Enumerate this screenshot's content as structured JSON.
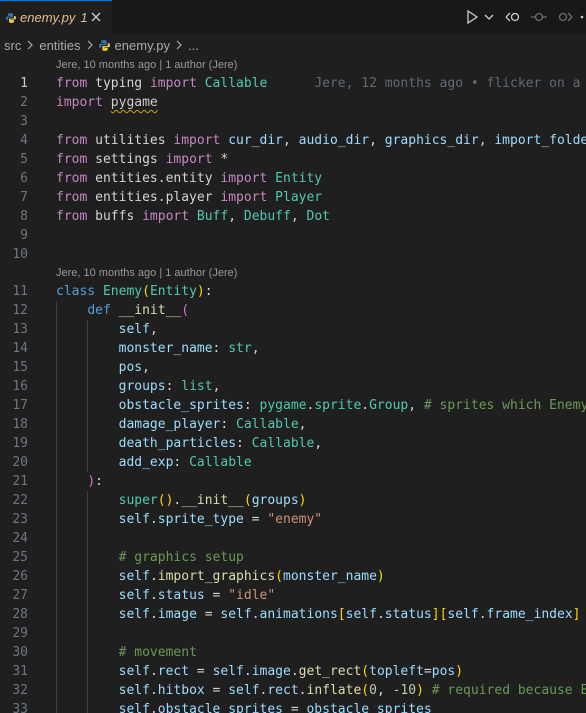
{
  "tab": {
    "filename": "enemy.py",
    "problem_count": "1"
  },
  "breadcrumb": [
    "src",
    "entities",
    "enemy.py",
    "..."
  ],
  "codelens": [
    {
      "before_line": 1,
      "text": "Jere, 10 months ago | 1 author (Jere)"
    },
    {
      "before_line": 11,
      "text": "Jere, 10 months ago | 1 author (Jere)"
    }
  ],
  "inline_blame": "Jere, 12 months ago • flicker on a",
  "lines": [
    {
      "n": "1",
      "tokens": [
        [
          "ctl",
          "from"
        ],
        [
          "plain",
          " "
        ],
        [
          "plain",
          "typing"
        ],
        [
          "plain",
          " "
        ],
        [
          "ctl",
          "import"
        ],
        [
          "plain",
          " "
        ],
        [
          "cls",
          "Callable"
        ]
      ]
    },
    {
      "n": "2",
      "tokens": [
        [
          "ctl",
          "import"
        ],
        [
          "plain",
          " "
        ],
        [
          "squig",
          "pygame"
        ]
      ]
    },
    {
      "n": "3",
      "tokens": []
    },
    {
      "n": "4",
      "tokens": [
        [
          "ctl",
          "from"
        ],
        [
          "plain",
          " utilities "
        ],
        [
          "ctl",
          "import"
        ],
        [
          "plain",
          " "
        ],
        [
          "var",
          "cur_dir"
        ],
        [
          "plain",
          ", "
        ],
        [
          "var",
          "audio_dir"
        ],
        [
          "plain",
          ", "
        ],
        [
          "var",
          "graphics_dir"
        ],
        [
          "plain",
          ", "
        ],
        [
          "var",
          "import_folder"
        ]
      ]
    },
    {
      "n": "5",
      "tokens": [
        [
          "ctl",
          "from"
        ],
        [
          "plain",
          " settings "
        ],
        [
          "ctl",
          "import"
        ],
        [
          "plain",
          " *"
        ]
      ]
    },
    {
      "n": "6",
      "tokens": [
        [
          "ctl",
          "from"
        ],
        [
          "plain",
          " entities.entity "
        ],
        [
          "ctl",
          "import"
        ],
        [
          "plain",
          " "
        ],
        [
          "cls",
          "Entity"
        ]
      ]
    },
    {
      "n": "7",
      "tokens": [
        [
          "ctl",
          "from"
        ],
        [
          "plain",
          " entities.player "
        ],
        [
          "ctl",
          "import"
        ],
        [
          "plain",
          " "
        ],
        [
          "cls",
          "Player"
        ]
      ]
    },
    {
      "n": "8",
      "tokens": [
        [
          "ctl",
          "from"
        ],
        [
          "plain",
          " buffs "
        ],
        [
          "ctl",
          "import"
        ],
        [
          "plain",
          " "
        ],
        [
          "cls",
          "Buff"
        ],
        [
          "plain",
          ", "
        ],
        [
          "cls",
          "Debuff"
        ],
        [
          "plain",
          ", "
        ],
        [
          "cls",
          "Dot"
        ]
      ]
    },
    {
      "n": "9",
      "tokens": []
    },
    {
      "n": "10",
      "tokens": []
    },
    {
      "n": "11",
      "tokens": [
        [
          "kw",
          "class"
        ],
        [
          "plain",
          " "
        ],
        [
          "cls",
          "Enemy"
        ],
        [
          "b1",
          "("
        ],
        [
          "cls",
          "Entity"
        ],
        [
          "b1",
          ")"
        ],
        [
          "plain",
          ":"
        ]
      ]
    },
    {
      "n": "12",
      "tokens": [
        [
          "plain",
          "    "
        ],
        [
          "kw",
          "def"
        ],
        [
          "plain",
          " "
        ],
        [
          "fn",
          "__init__"
        ],
        [
          "b2",
          "("
        ]
      ]
    },
    {
      "n": "13",
      "tokens": [
        [
          "plain",
          "        "
        ],
        [
          "var",
          "self"
        ],
        [
          "plain",
          ","
        ]
      ]
    },
    {
      "n": "14",
      "tokens": [
        [
          "plain",
          "        "
        ],
        [
          "var",
          "monster_name"
        ],
        [
          "plain",
          ": "
        ],
        [
          "cls",
          "str"
        ],
        [
          "plain",
          ","
        ]
      ]
    },
    {
      "n": "15",
      "tokens": [
        [
          "plain",
          "        "
        ],
        [
          "var",
          "pos"
        ],
        [
          "plain",
          ","
        ]
      ]
    },
    {
      "n": "16",
      "tokens": [
        [
          "plain",
          "        "
        ],
        [
          "var",
          "groups"
        ],
        [
          "plain",
          ": "
        ],
        [
          "cls",
          "list"
        ],
        [
          "plain",
          ","
        ]
      ]
    },
    {
      "n": "17",
      "tokens": [
        [
          "plain",
          "        "
        ],
        [
          "var",
          "obstacle_sprites"
        ],
        [
          "plain",
          ": "
        ],
        [
          "cls",
          "pygame"
        ],
        [
          "plain",
          "."
        ],
        [
          "cls",
          "sprite"
        ],
        [
          "plain",
          "."
        ],
        [
          "cls",
          "Group"
        ],
        [
          "plain",
          ", "
        ],
        [
          "cmt",
          "# sprites which Enemy"
        ]
      ]
    },
    {
      "n": "18",
      "tokens": [
        [
          "plain",
          "        "
        ],
        [
          "var",
          "damage_player"
        ],
        [
          "plain",
          ": "
        ],
        [
          "cls",
          "Callable"
        ],
        [
          "plain",
          ","
        ]
      ]
    },
    {
      "n": "19",
      "tokens": [
        [
          "plain",
          "        "
        ],
        [
          "var",
          "death_particles"
        ],
        [
          "plain",
          ": "
        ],
        [
          "cls",
          "Callable"
        ],
        [
          "plain",
          ","
        ]
      ]
    },
    {
      "n": "20",
      "tokens": [
        [
          "plain",
          "        "
        ],
        [
          "var",
          "add_exp"
        ],
        [
          "plain",
          ": "
        ],
        [
          "cls",
          "Callable"
        ]
      ]
    },
    {
      "n": "21",
      "tokens": [
        [
          "plain",
          "    "
        ],
        [
          "b2",
          ")"
        ],
        [
          "plain",
          ":"
        ]
      ]
    },
    {
      "n": "22",
      "tokens": [
        [
          "plain",
          "        "
        ],
        [
          "cls",
          "super"
        ],
        [
          "b1",
          "()"
        ],
        [
          "plain",
          "."
        ],
        [
          "fn",
          "__init__"
        ],
        [
          "b1",
          "("
        ],
        [
          "var",
          "groups"
        ],
        [
          "b1",
          ")"
        ]
      ]
    },
    {
      "n": "23",
      "tokens": [
        [
          "plain",
          "        "
        ],
        [
          "var",
          "self"
        ],
        [
          "plain",
          "."
        ],
        [
          "var",
          "sprite_type"
        ],
        [
          "plain",
          " = "
        ],
        [
          "str",
          "\"enemy\""
        ]
      ]
    },
    {
      "n": "24",
      "tokens": []
    },
    {
      "n": "25",
      "tokens": [
        [
          "plain",
          "        "
        ],
        [
          "cmt",
          "# graphics setup"
        ]
      ]
    },
    {
      "n": "26",
      "tokens": [
        [
          "plain",
          "        "
        ],
        [
          "var",
          "self"
        ],
        [
          "plain",
          "."
        ],
        [
          "fn",
          "import_graphics"
        ],
        [
          "b1",
          "("
        ],
        [
          "var",
          "monster_name"
        ],
        [
          "b1",
          ")"
        ]
      ]
    },
    {
      "n": "27",
      "tokens": [
        [
          "plain",
          "        "
        ],
        [
          "var",
          "self"
        ],
        [
          "plain",
          "."
        ],
        [
          "var",
          "status"
        ],
        [
          "plain",
          " = "
        ],
        [
          "str",
          "\"idle\""
        ]
      ]
    },
    {
      "n": "28",
      "tokens": [
        [
          "plain",
          "        "
        ],
        [
          "var",
          "self"
        ],
        [
          "plain",
          "."
        ],
        [
          "var",
          "image"
        ],
        [
          "plain",
          " = "
        ],
        [
          "var",
          "self"
        ],
        [
          "plain",
          "."
        ],
        [
          "var",
          "animations"
        ],
        [
          "b1",
          "["
        ],
        [
          "var",
          "self"
        ],
        [
          "plain",
          "."
        ],
        [
          "var",
          "status"
        ],
        [
          "b1",
          "]["
        ],
        [
          "var",
          "self"
        ],
        [
          "plain",
          "."
        ],
        [
          "var",
          "frame_index"
        ],
        [
          "b1",
          "]"
        ]
      ]
    },
    {
      "n": "29",
      "tokens": []
    },
    {
      "n": "30",
      "tokens": [
        [
          "plain",
          "        "
        ],
        [
          "cmt",
          "# movement"
        ]
      ]
    },
    {
      "n": "31",
      "tokens": [
        [
          "plain",
          "        "
        ],
        [
          "var",
          "self"
        ],
        [
          "plain",
          "."
        ],
        [
          "var",
          "rect"
        ],
        [
          "plain",
          " = "
        ],
        [
          "var",
          "self"
        ],
        [
          "plain",
          "."
        ],
        [
          "var",
          "image"
        ],
        [
          "plain",
          "."
        ],
        [
          "fn",
          "get_rect"
        ],
        [
          "b1",
          "("
        ],
        [
          "var",
          "topleft"
        ],
        [
          "plain",
          "="
        ],
        [
          "var",
          "pos"
        ],
        [
          "b1",
          ")"
        ]
      ]
    },
    {
      "n": "32",
      "tokens": [
        [
          "plain",
          "        "
        ],
        [
          "var",
          "self"
        ],
        [
          "plain",
          "."
        ],
        [
          "var",
          "hitbox"
        ],
        [
          "plain",
          " = "
        ],
        [
          "var",
          "self"
        ],
        [
          "plain",
          "."
        ],
        [
          "var",
          "rect"
        ],
        [
          "plain",
          "."
        ],
        [
          "fn",
          "inflate"
        ],
        [
          "b1",
          "("
        ],
        [
          "num",
          "0"
        ],
        [
          "plain",
          ", "
        ],
        [
          "num",
          "-10"
        ],
        [
          "b1",
          ")"
        ],
        [
          "plain",
          " "
        ],
        [
          "cmt",
          "# required because E"
        ]
      ]
    },
    {
      "n": "33",
      "tokens": [
        [
          "plain",
          "        "
        ],
        [
          "var",
          "self"
        ],
        [
          "plain",
          "."
        ],
        [
          "var",
          "obstacle_sprites"
        ],
        [
          "plain",
          " = "
        ],
        [
          "var",
          "obstacle_sprites"
        ]
      ]
    }
  ],
  "colors": {
    "accent": "#0078d4",
    "modified": "#e2c08d"
  },
  "icons": [
    "python-file-icon",
    "close-icon",
    "run-icon",
    "chevron-down-icon",
    "go-back-icon",
    "git-commit-icon",
    "go-forward-icon",
    "more-actions-icon"
  ]
}
